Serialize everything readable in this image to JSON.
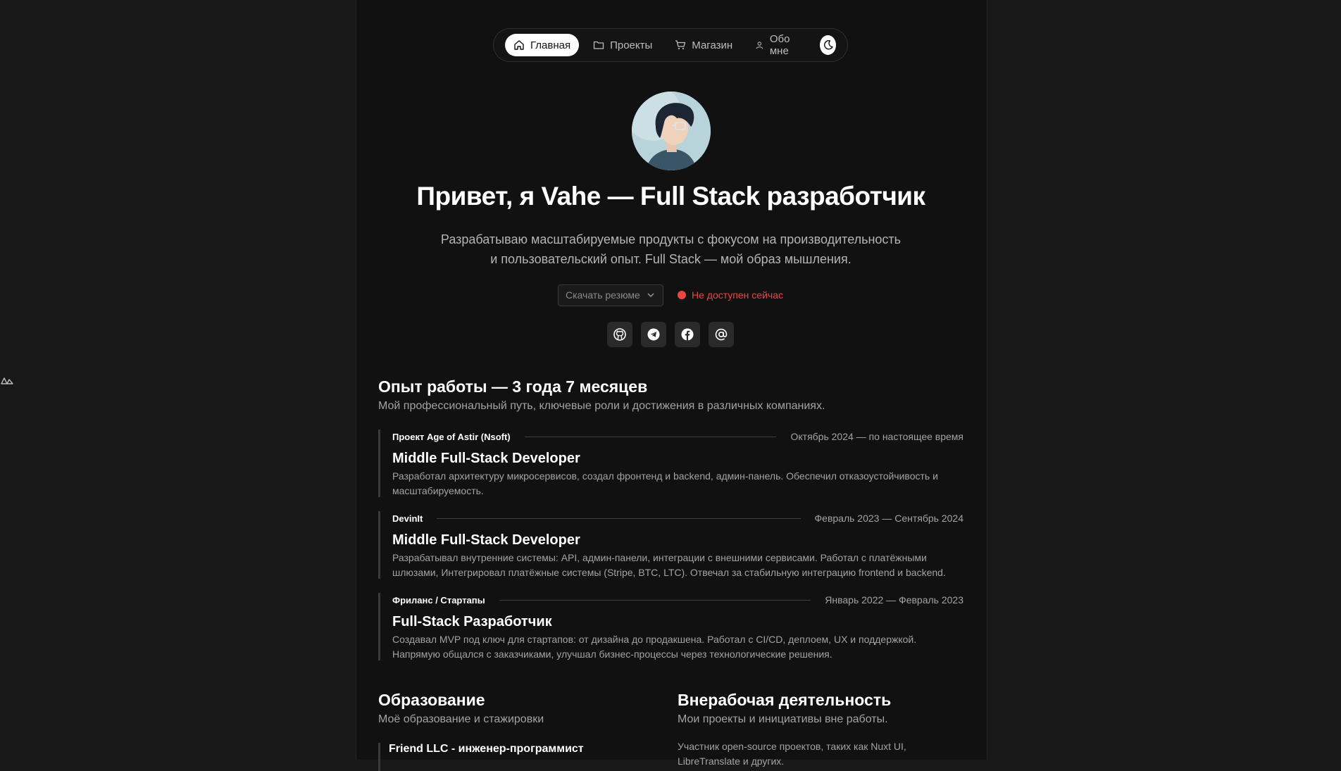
{
  "nav": {
    "items": [
      {
        "label": "Главная",
        "icon": "home-icon",
        "active": true
      },
      {
        "label": "Проекты",
        "icon": "folder-icon",
        "active": false
      },
      {
        "label": "Магазин",
        "icon": "cart-icon",
        "active": false
      },
      {
        "label": "Обо мне",
        "icon": "user-icon",
        "active": false
      }
    ],
    "theme_toggle_icon": "moon-icon"
  },
  "hero": {
    "title": "Привет, я Vahe — Full Stack разработчик",
    "subtitle_line1": "Разрабатываю масштабируемые продукты с фокусом на производительность",
    "subtitle_line2": "и пользовательский опыт. Full Stack — мой образ мышления.",
    "resume_placeholder": "Скачать резюме",
    "status": "Не доступен сейчас",
    "status_color": "#ef4444",
    "socials": [
      "github-icon",
      "telegram-icon",
      "facebook-icon",
      "at-sign-icon"
    ]
  },
  "experience": {
    "title": "Опыт работы — 3 года 7 месяцев",
    "subtitle": "Мой профессиональный путь, ключевые роли и достижения в различных компаниях.",
    "items": [
      {
        "company": "Проект Age of Astir (Nsoft)",
        "date": "Октябрь 2024 — по настоящее время",
        "role": "Middle Full-Stack Developer",
        "description": "Разработал архитектуру микросервисов, создал фронтенд и backend, админ-панель. Обеспечил отказоустойчивость и масштабируемость."
      },
      {
        "company": "DevinIt",
        "date": "Февраль 2023 — Сентябрь 2024",
        "role": "Middle Full-Stack Developer",
        "description": "Разрабатывал внутренние системы: API, админ-панели, интеграции с внешними сервисами. Работал с платёжными шлюзами, Интегрировал платёжные системы (Stripe, BTC, LTC). Отвечал за стабильную интеграцию frontend и backend."
      },
      {
        "company": "Фриланс / Стартапы",
        "date": "Январь 2022 — Февраль 2023",
        "role": "Full-Stack Разработчик",
        "description": "Создавал MVP под ключ для стартапов: от дизайна до продакшена. Работал с CI/CD, деплоем, UX и поддержкой. Напрямую общался с заказчиками, улучшал бизнес-процессы через технологические решения."
      }
    ]
  },
  "education": {
    "title": "Образование",
    "subtitle": "Моё образование и стажировки",
    "first_item": "Friend LLC - инженер-программист"
  },
  "extra": {
    "title": "Внерабочая деятельность",
    "subtitle": "Мои проекты и инициативы вне работы.",
    "text": "Участник open-source проектов, таких как Nuxt UI, LibreTranslate и других."
  }
}
